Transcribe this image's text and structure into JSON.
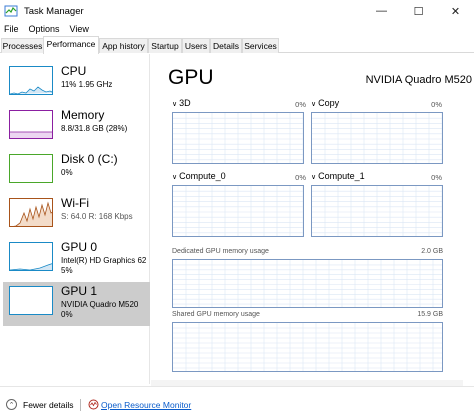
{
  "window": {
    "title": "Task Manager",
    "controls": {
      "minimize": "—",
      "maximize": "☐",
      "close": "✕"
    }
  },
  "menu": [
    "File",
    "Options",
    "View"
  ],
  "tabs": [
    {
      "label": "Processes",
      "active": false
    },
    {
      "label": "Performance",
      "active": true
    },
    {
      "label": "App history",
      "active": false
    },
    {
      "label": "Startup",
      "active": false
    },
    {
      "label": "Users",
      "active": false
    },
    {
      "label": "Details",
      "active": false
    },
    {
      "label": "Services",
      "active": false
    }
  ],
  "sidebar": {
    "items": [
      {
        "title": "CPU",
        "line1": "11%  1.95 GHz",
        "line2": "",
        "color": "#1a8ac6",
        "active": false
      },
      {
        "title": "Memory",
        "line1": "8.8/31.8 GB (28%)",
        "line2": "",
        "color": "#8b1fa1",
        "active": false
      },
      {
        "title": "Disk 0 (C:)",
        "line1": "0%",
        "line2": "",
        "color": "#4aa72a",
        "active": false
      },
      {
        "title": "Wi-Fi",
        "line1": "S: 64.0  R: 168 Kbps",
        "line2": "",
        "color": "#a8531a",
        "active": false
      },
      {
        "title": "GPU 0",
        "line1": "Intel(R) HD Graphics 62",
        "line2": "5%",
        "color": "#1a8ac6",
        "active": false
      },
      {
        "title": "GPU 1",
        "line1": "NVIDIA Quadro M520",
        "line2": "0%",
        "color": "#1a8ac6",
        "active": true
      }
    ]
  },
  "main": {
    "title": "GPU",
    "device_name": "NVIDIA Quadro M520",
    "graphs": [
      {
        "label": "3D",
        "pct": "0%"
      },
      {
        "label": "Copy",
        "pct": "0%"
      },
      {
        "label": "Compute_0",
        "pct": "0%"
      },
      {
        "label": "Compute_1",
        "pct": "0%"
      }
    ],
    "dedicated": {
      "label": "Dedicated GPU memory usage",
      "value": "2.0 GB"
    },
    "shared": {
      "label": "Shared GPU memory usage",
      "value": "15.9 GB"
    }
  },
  "footer": {
    "fewer_details": "Fewer details",
    "open_resource_monitor": "Open Resource Monitor"
  },
  "colors": {
    "graph_border": "#7b98c2",
    "grid_line": "#dbe6f4",
    "link": "#0a5ccb",
    "selected_bg": "#cccccc"
  }
}
